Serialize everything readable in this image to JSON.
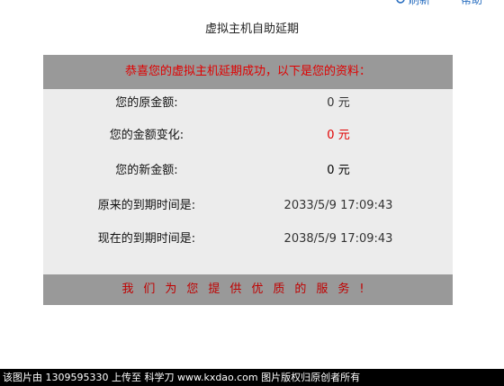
{
  "toolbar": {
    "refresh_label": "刷新",
    "help_label": "帮助",
    "refresh_icon": "refresh-icon",
    "accent_color": "#2a6fc0"
  },
  "page": {
    "title": "虚拟主机自助延期"
  },
  "panel": {
    "header_text": "恭喜您的虚拟主机延期成功，以下是您的资料：",
    "header_color": "#e00000",
    "rows": [
      {
        "label": "您的原金额:",
        "value": "0 元"
      },
      {
        "label": "您的金额变化:",
        "value": "0 元"
      },
      {
        "label": "您的新金额:",
        "value": "0 元"
      },
      {
        "label": "原来的到期时间是:",
        "value": "2033/5/9 17:09:43"
      },
      {
        "label": "现在的到期时间是:",
        "value": "2038/5/9 17:09:43"
      }
    ],
    "footer_text": "我们为您提供优质的服务!"
  },
  "watermark": {
    "text": "该图片由 1309595330 上传至 科学刀 www.kxdao.com 图片版权归原创者所有"
  }
}
